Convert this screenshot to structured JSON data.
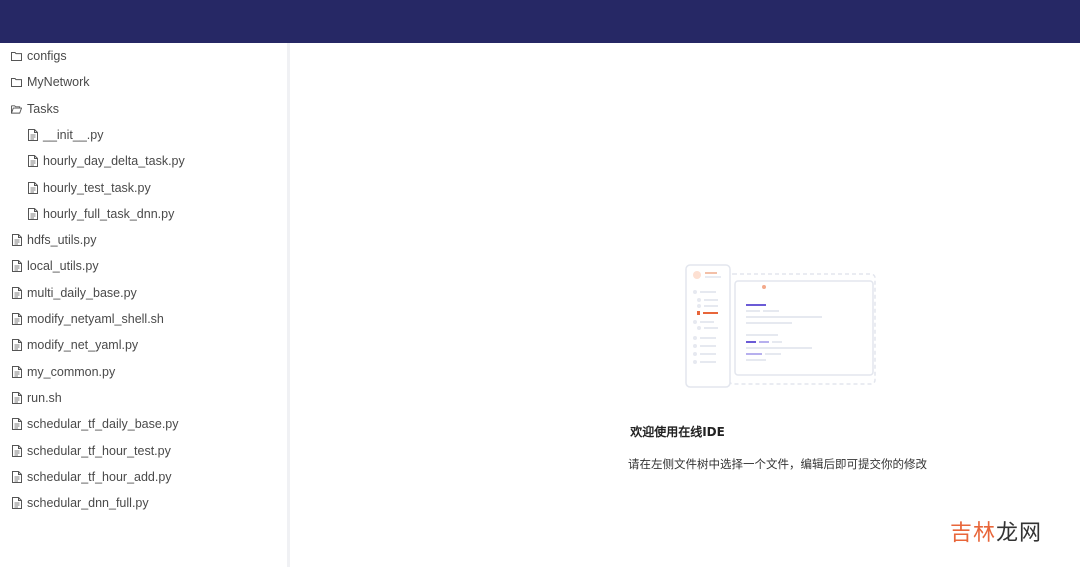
{
  "file_tree": {
    "items": [
      {
        "label": "configs",
        "kind": "folder",
        "depth": 0
      },
      {
        "label": "MyNetwork",
        "kind": "folder",
        "depth": 0
      },
      {
        "label": "Tasks",
        "kind": "folder-open",
        "depth": 0
      },
      {
        "label": "__init__.py",
        "kind": "file",
        "depth": 1
      },
      {
        "label": "hourly_day_delta_task.py",
        "kind": "file",
        "depth": 1
      },
      {
        "label": "hourly_test_task.py",
        "kind": "file",
        "depth": 1
      },
      {
        "label": "hourly_full_task_dnn.py",
        "kind": "file",
        "depth": 1
      },
      {
        "label": "hdfs_utils.py",
        "kind": "file",
        "depth": 0
      },
      {
        "label": "local_utils.py",
        "kind": "file",
        "depth": 0
      },
      {
        "label": "multi_daily_base.py",
        "kind": "file",
        "depth": 0
      },
      {
        "label": "modify_netyaml_shell.sh",
        "kind": "file",
        "depth": 0
      },
      {
        "label": "modify_net_yaml.py",
        "kind": "file",
        "depth": 0
      },
      {
        "label": "my_common.py",
        "kind": "file",
        "depth": 0
      },
      {
        "label": "run.sh",
        "kind": "file",
        "depth": 0
      },
      {
        "label": "schedular_tf_daily_base.py",
        "kind": "file",
        "depth": 0
      },
      {
        "label": "schedular_tf_hour_test.py",
        "kind": "file",
        "depth": 0
      },
      {
        "label": "schedular_tf_hour_add.py",
        "kind": "file",
        "depth": 0
      },
      {
        "label": "schedular_dnn_full.py",
        "kind": "file",
        "depth": 0
      }
    ]
  },
  "main": {
    "welcome_title": "欢迎使用在线IDE",
    "welcome_hint": "请在左侧文件树中选择一个文件，编辑后即可提交你的修改"
  },
  "watermark": {
    "part_a": "吉林",
    "part_b": "龙网"
  },
  "colors": {
    "topbar": "#262865",
    "accent_orange": "#e8663a",
    "accent_purple": "#6b5bd6"
  }
}
